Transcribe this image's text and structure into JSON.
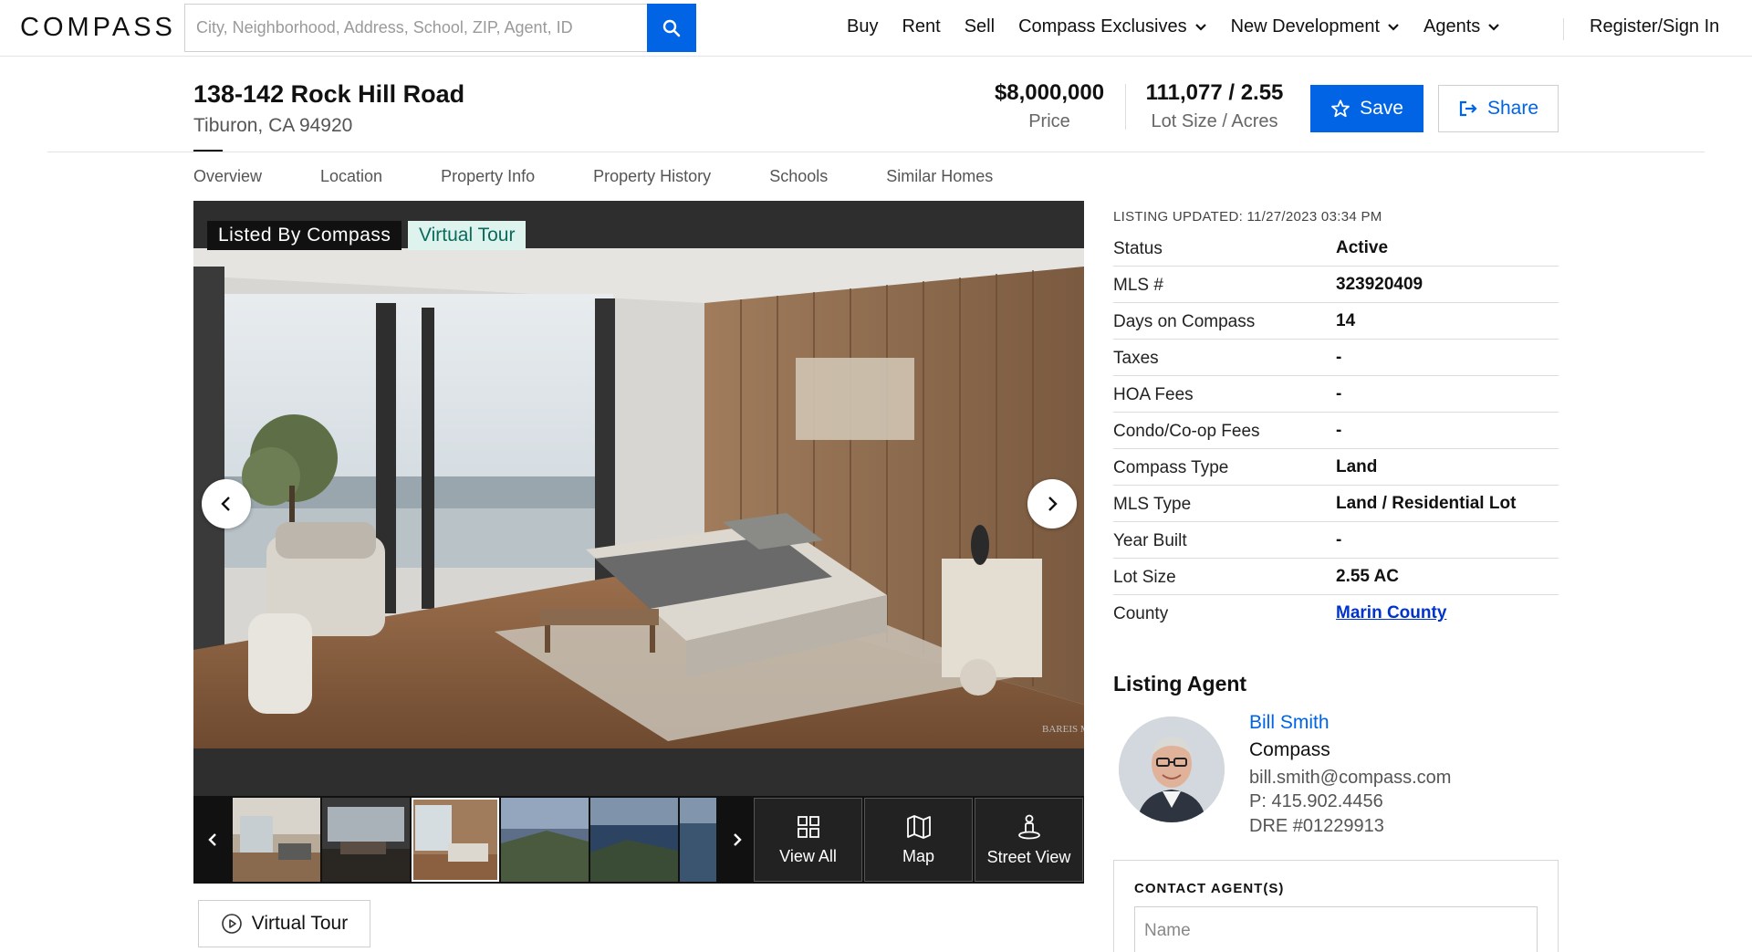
{
  "brand": {
    "logo": "COMPASS",
    "accent": "#0064e5"
  },
  "search": {
    "placeholder": "City, Neighborhood, Address, School, ZIP, Agent, ID",
    "value": ""
  },
  "nav": {
    "items": [
      {
        "label": "Buy",
        "dropdown": false
      },
      {
        "label": "Rent",
        "dropdown": false
      },
      {
        "label": "Sell",
        "dropdown": false
      },
      {
        "label": "Compass Exclusives",
        "dropdown": true
      },
      {
        "label": "New Development",
        "dropdown": true
      },
      {
        "label": "Agents",
        "dropdown": true
      }
    ],
    "signin": "Register/Sign In"
  },
  "listing": {
    "address": "138-142 Rock Hill Road",
    "city": "Tiburon, CA 94920",
    "price": "$8,000,000",
    "price_label": "Price",
    "lot": "111,077 / 2.55",
    "lot_label": "Lot Size / Acres",
    "save_label": "Save",
    "share_label": "Share"
  },
  "tabs": [
    "Overview",
    "Location",
    "Property Info",
    "Property History",
    "Schools",
    "Similar Homes"
  ],
  "gallery": {
    "badge_listed": "Listed By Compass",
    "badge_tour": "Virtual Tour",
    "watermark": "BAREIS MLS",
    "view_all": "View All",
    "map": "Map",
    "street_view": "Street View",
    "virtual_tour_button": "Virtual Tour"
  },
  "details": {
    "updated": "LISTING UPDATED: 11/27/2023 03:34 PM",
    "rows": [
      {
        "key": "Status",
        "value": "Active"
      },
      {
        "key": "MLS #",
        "value": "323920409"
      },
      {
        "key": "Days on Compass",
        "value": "14"
      },
      {
        "key": "Taxes",
        "value": "-"
      },
      {
        "key": "HOA Fees",
        "value": "-"
      },
      {
        "key": "Condo/Co-op Fees",
        "value": "-"
      },
      {
        "key": "Compass Type",
        "value": "Land"
      },
      {
        "key": "MLS Type",
        "value": "Land / Residential Lot"
      },
      {
        "key": "Year Built",
        "value": "-"
      },
      {
        "key": "Lot Size",
        "value": "2.55 AC"
      },
      {
        "key": "County",
        "value": "Marin County",
        "link": true
      }
    ]
  },
  "agent": {
    "section_title": "Listing Agent",
    "name": "Bill Smith",
    "company": "Compass",
    "email": "bill.smith@compass.com",
    "phone": "P: 415.902.4456",
    "dre": "DRE #01229913"
  },
  "contact": {
    "title": "CONTACT AGENT(S)",
    "name_placeholder": "Name"
  }
}
